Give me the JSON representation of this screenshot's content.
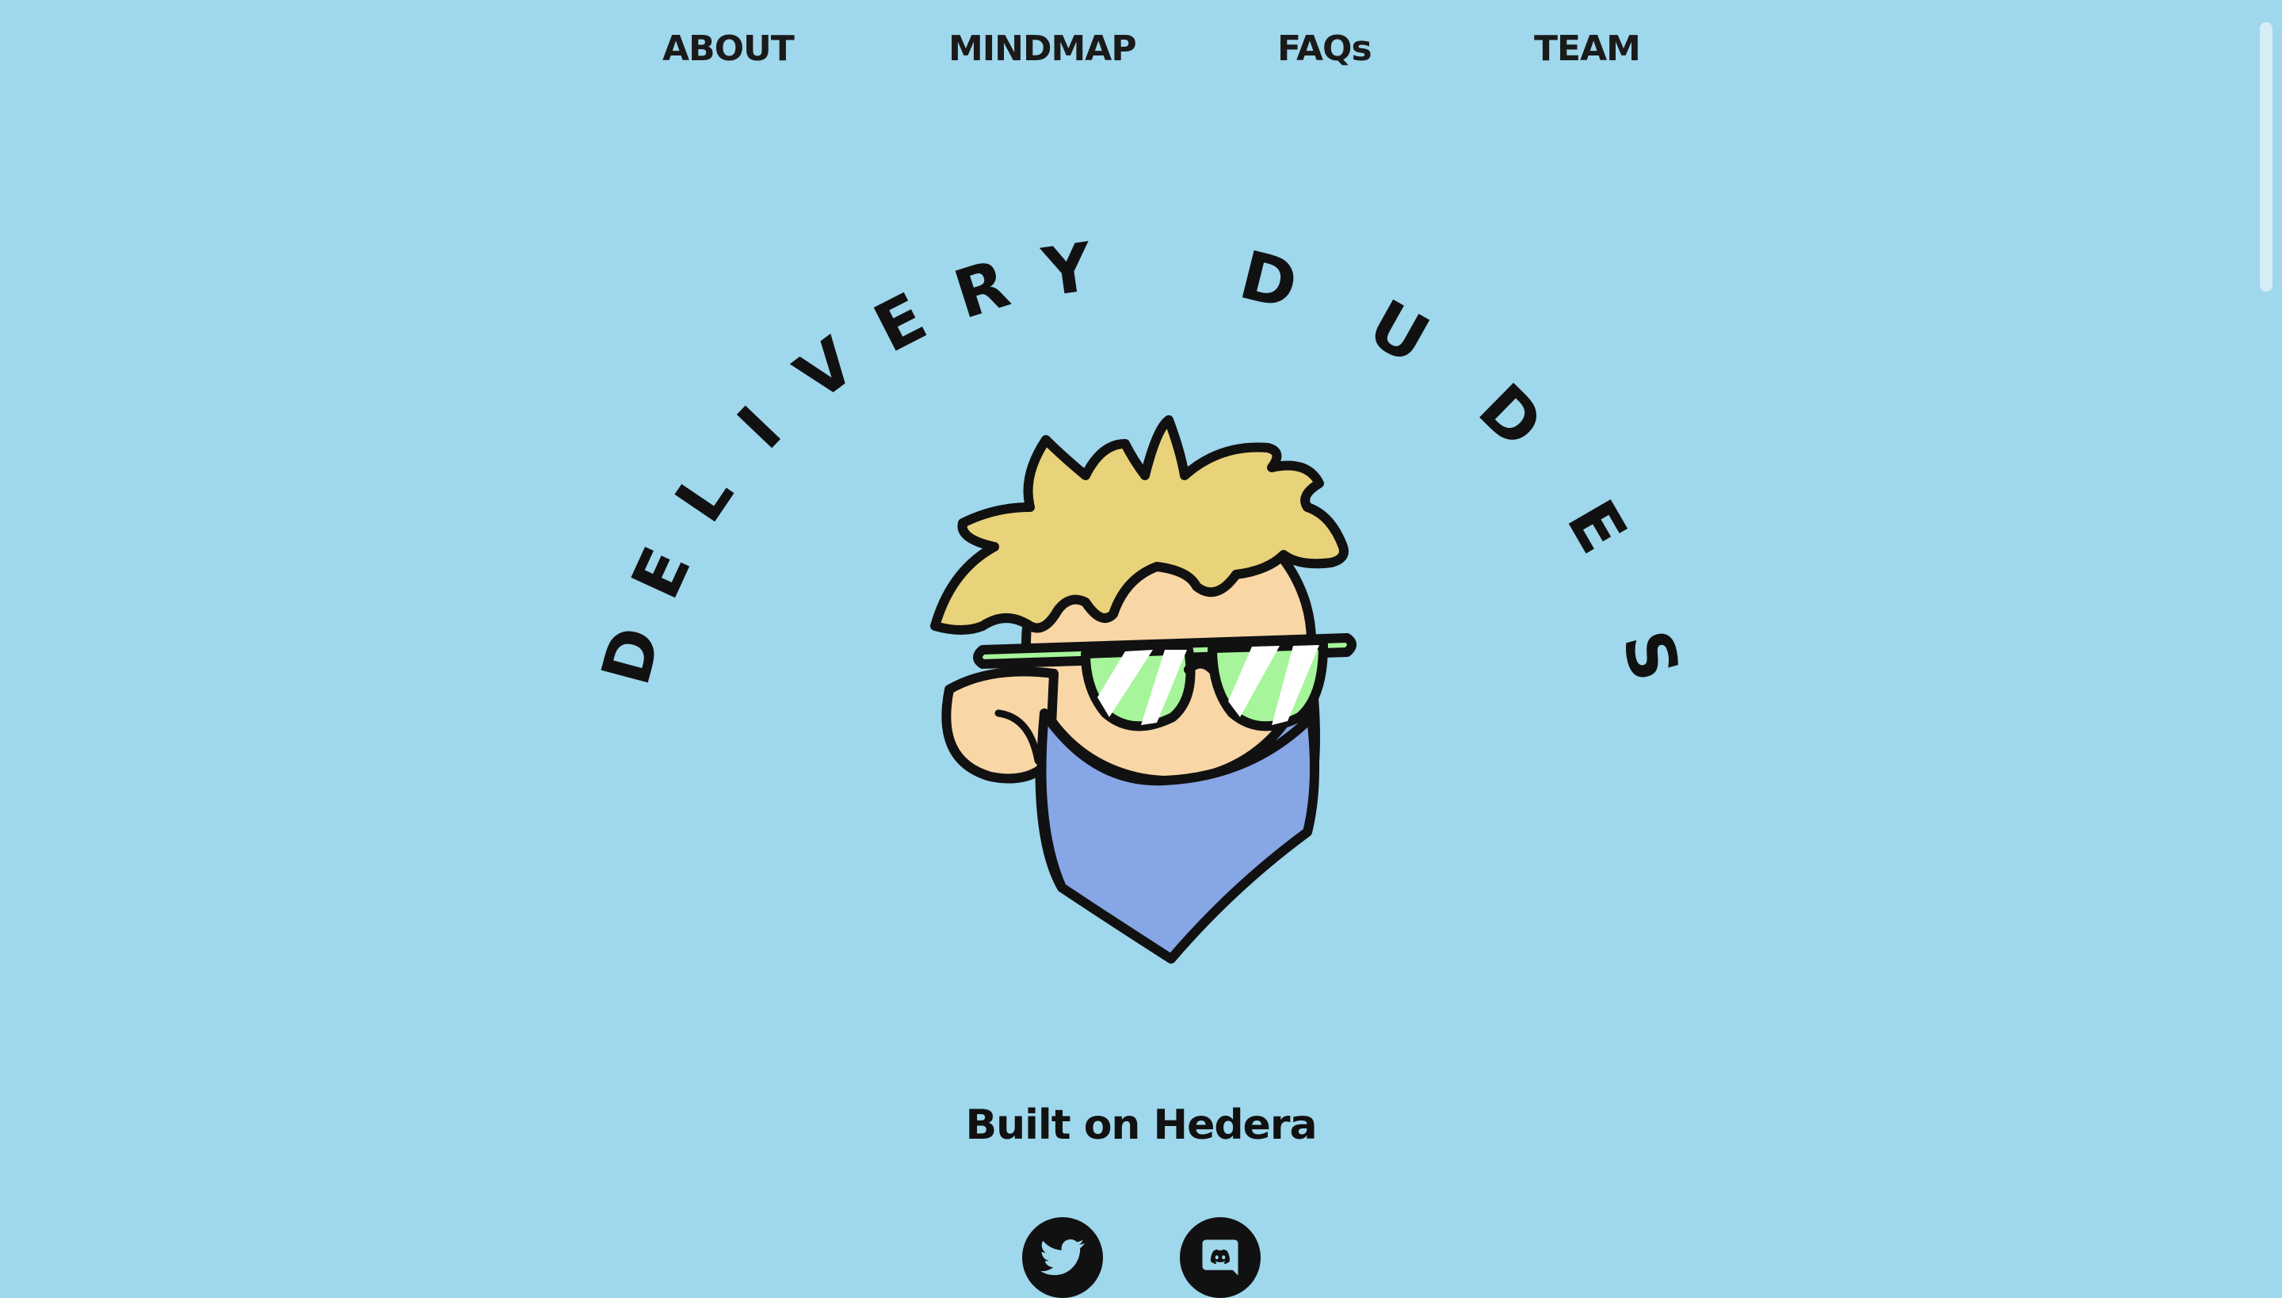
{
  "nav": {
    "items": [
      {
        "label": "ABOUT"
      },
      {
        "label": "MINDMAP"
      },
      {
        "label": "FAQs"
      },
      {
        "label": "TEAM"
      }
    ]
  },
  "hero": {
    "arc_word_left": "DELIVERY",
    "arc_word_right": "DUDES",
    "mascot": "delivery-dude-mascot"
  },
  "tagline": "Built on Hedera",
  "social": [
    {
      "icon": "twitter-icon"
    },
    {
      "icon": "discord-icon"
    }
  ],
  "colors": {
    "background": "#9fd7ec",
    "hair": "#e8d27a",
    "skin": "#f9d6a6",
    "mask": "#86a6e6",
    "lens": "#a6f59a",
    "ink": "#111111"
  }
}
